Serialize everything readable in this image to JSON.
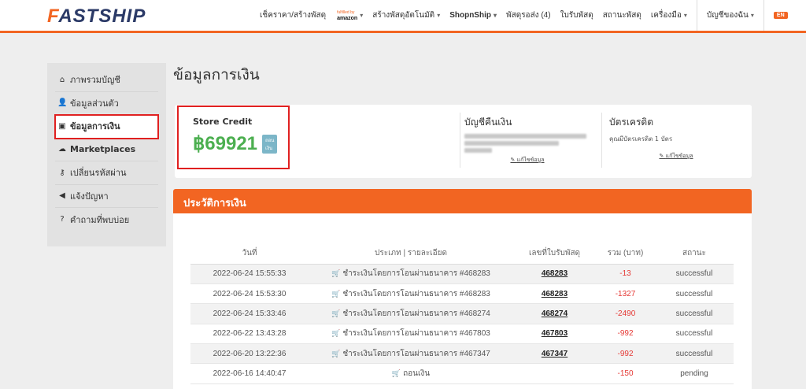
{
  "brand": {
    "logo_accent": "F",
    "logo_rest": "ASTSHIP",
    "accent_color": "#f26522",
    "navy_color": "#2b3a67"
  },
  "nav": {
    "items": [
      {
        "label": "เช็คราคา/สร้างพัสดุ"
      },
      {
        "label": "fulfilled by",
        "label2": "amazon"
      },
      {
        "label": "สร้างพัสดุอัตโนมัติ"
      },
      {
        "label": "ShopnShip"
      },
      {
        "label": "พัสดุรอส่ง (4)"
      },
      {
        "label": "ใบรับพัสดุ"
      },
      {
        "label": "สถานะพัสดุ"
      },
      {
        "label": "เครื่องมือ"
      },
      {
        "label": "บัญชีของฉัน"
      }
    ],
    "lang": "EN"
  },
  "sidebar": {
    "items": [
      {
        "label": "ภาพรวมบัญชี",
        "icon": "home-icon"
      },
      {
        "label": "ข้อมูลส่วนตัว",
        "icon": "user-icon"
      },
      {
        "label": "ข้อมูลการเงิน",
        "icon": "money-icon",
        "active": true
      },
      {
        "label": "Marketplaces",
        "icon": "cloud-icon"
      },
      {
        "label": "เปลี่ยนรหัสผ่าน",
        "icon": "key-icon"
      },
      {
        "label": "แจ้งปัญหา",
        "icon": "bullhorn-icon"
      },
      {
        "label": "คำถามที่พบบ่อย",
        "icon": "question-icon"
      }
    ]
  },
  "main": {
    "title": "ข้อมูลการเงิน",
    "store_credit": {
      "title": "Store Credit",
      "amount": "฿69921",
      "withdraw_label": "ถอนเงิน"
    },
    "bank": {
      "title": "บัญชีคืนเงิน",
      "edit_label": "แก้ไขข้อมูล"
    },
    "credit_card": {
      "title": "บัตรเครดิต",
      "subtitle": "คุณมีบัตรเครดิต 1 บัตร",
      "edit_label": "แก้ไขข้อมูล"
    },
    "history": {
      "title": "ประวัติการเงิน",
      "columns": [
        "วันที่",
        "ประเภท | รายละเอียด",
        "เลขที่ใบรับพัสดุ",
        "รวม (บาท)",
        "สถานะ"
      ],
      "rows": [
        {
          "date": "2022-06-24 15:55:33",
          "detail": "ชำระเงินโดยการโอนผ่านธนาคาร #468283",
          "tracking": "468283",
          "total": "-13",
          "status": "successful"
        },
        {
          "date": "2022-06-24 15:53:30",
          "detail": "ชำระเงินโดยการโอนผ่านธนาคาร #468283",
          "tracking": "468283",
          "total": "-1327",
          "status": "successful"
        },
        {
          "date": "2022-06-24 15:33:46",
          "detail": "ชำระเงินโดยการโอนผ่านธนาคาร #468274",
          "tracking": "468274",
          "total": "-2490",
          "status": "successful"
        },
        {
          "date": "2022-06-22 13:43:28",
          "detail": "ชำระเงินโดยการโอนผ่านธนาคาร #467803",
          "tracking": "467803",
          "total": "-992",
          "status": "successful"
        },
        {
          "date": "2022-06-20 13:22:36",
          "detail": "ชำระเงินโดยการโอนผ่านธนาคาร #467347",
          "tracking": "467347",
          "total": "-992",
          "status": "successful"
        },
        {
          "date": "2022-06-16 14:40:47",
          "detail": "ถอนเงิน",
          "tracking": "",
          "total": "-150",
          "status": "pending"
        }
      ]
    }
  }
}
